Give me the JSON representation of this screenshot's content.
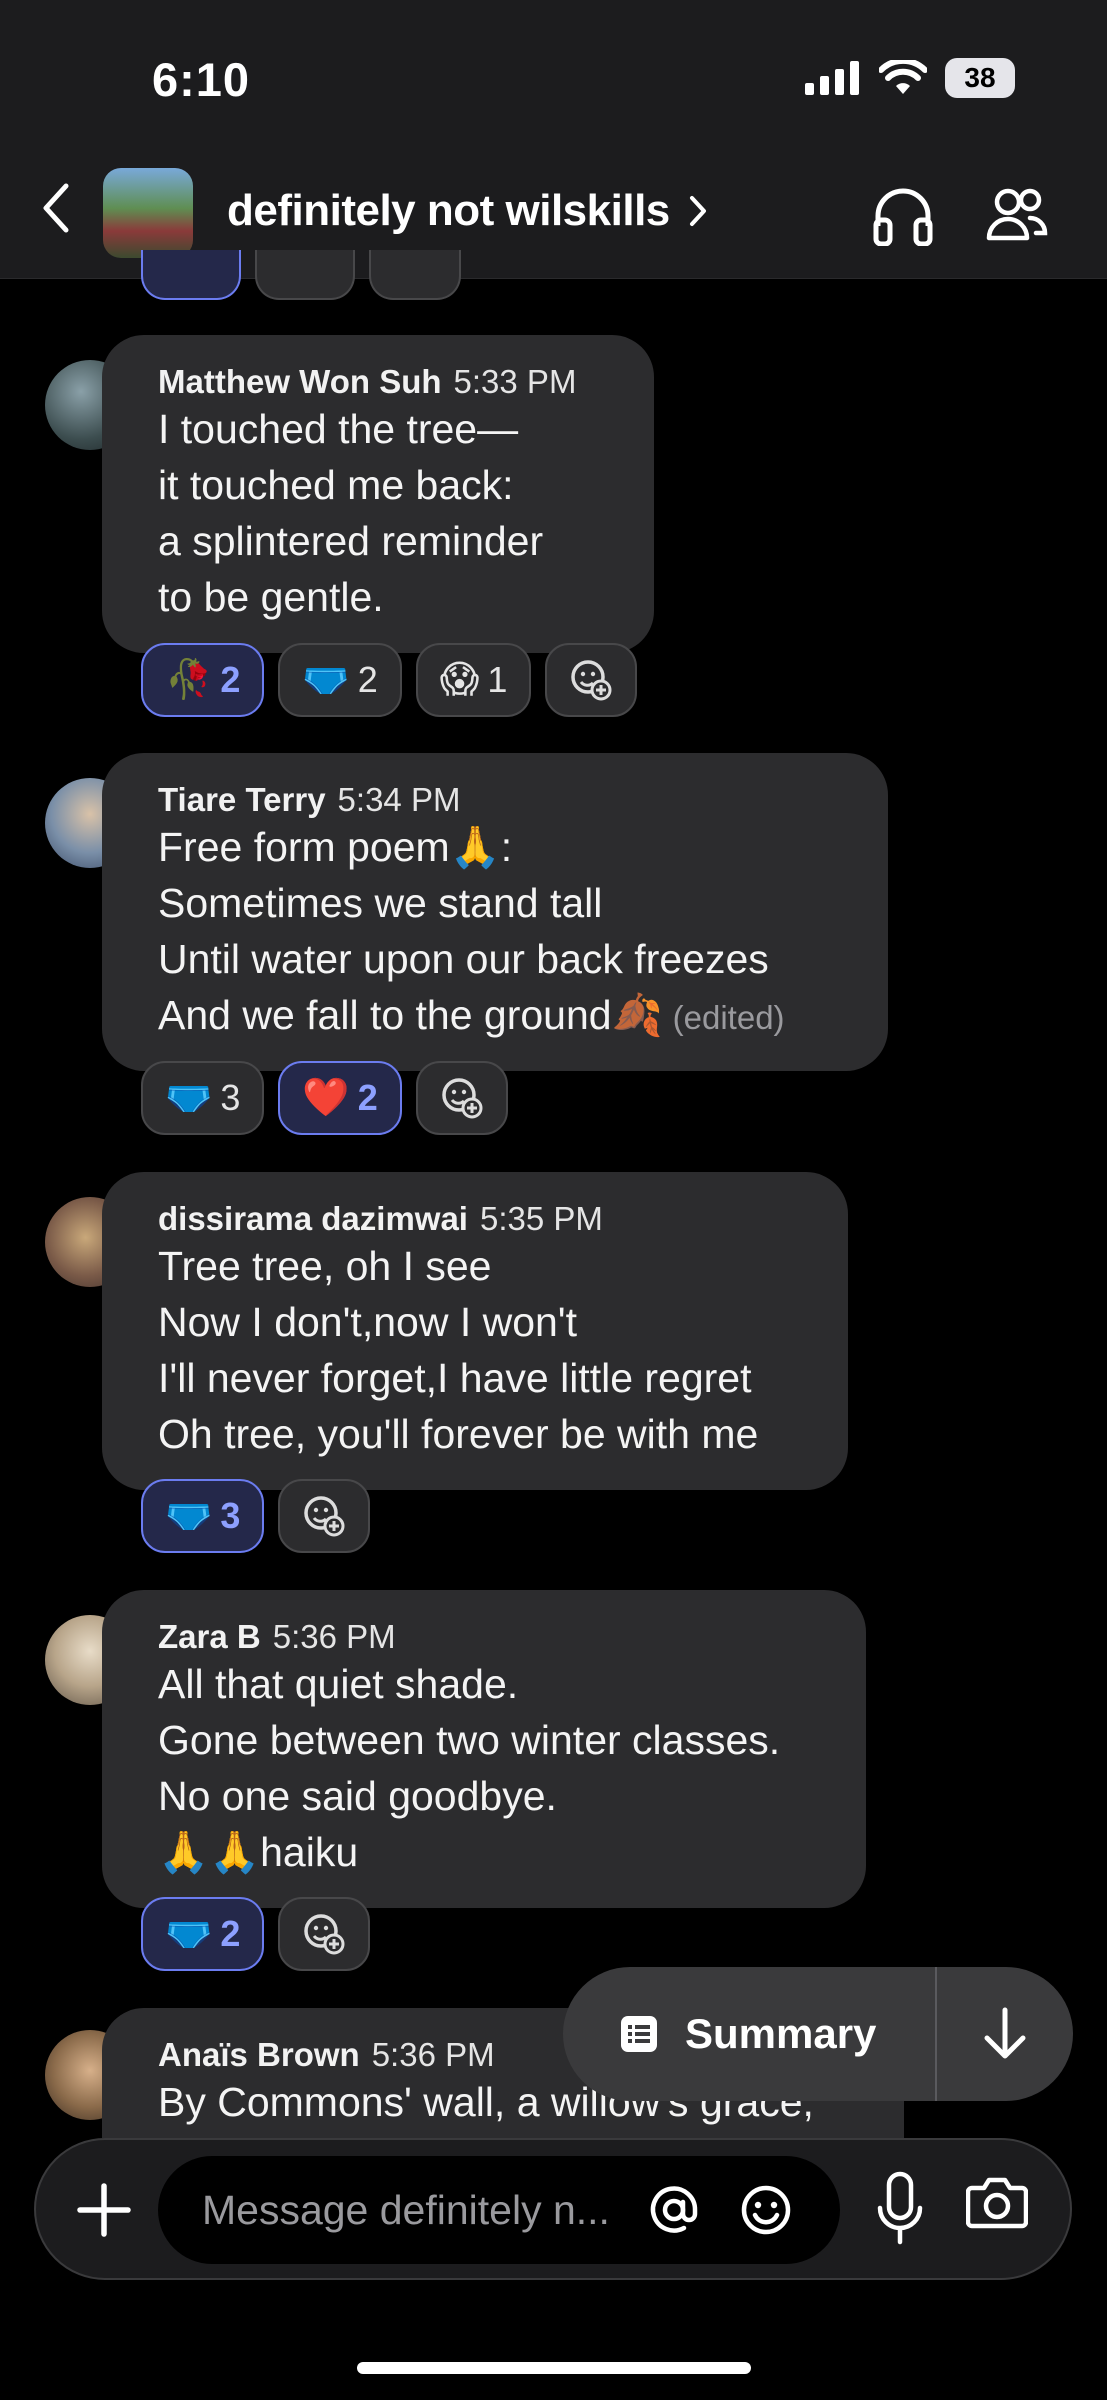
{
  "status_bar": {
    "time": "6:10",
    "battery": "38"
  },
  "header": {
    "title": "definitely not wilskills"
  },
  "messages": [
    {
      "sender": "Matthew Won Suh",
      "time": "5:33 PM",
      "lines": [
        "I touched the tree—",
        "it touched me back:",
        "a splintered reminder",
        "to be gentle."
      ],
      "reactions": [
        {
          "emoji": "🥀",
          "count": "2",
          "mine": true
        },
        {
          "emoji": "🩲",
          "count": "2",
          "mine": false
        },
        {
          "emoji": "😱",
          "count": "1",
          "mine": false
        }
      ]
    },
    {
      "sender": "Tiare Terry",
      "time": "5:34 PM",
      "lines": [
        "Free form poem🙏:",
        "Sometimes we stand tall",
        "Until water upon our back freezes",
        "And we fall to the ground🍂"
      ],
      "edited": "(edited)",
      "reactions": [
        {
          "emoji": "🩲",
          "count": "3",
          "mine": false
        },
        {
          "emoji": "❤️",
          "count": "2",
          "mine": true
        }
      ]
    },
    {
      "sender": "dissirama dazimwai",
      "time": "5:35 PM",
      "lines": [
        "Tree tree, oh I see",
        "Now I don't,now I won't",
        "I'll never forget,I have little regret",
        "Oh tree, you'll forever be with me"
      ],
      "reactions": [
        {
          "emoji": "🩲",
          "count": "3",
          "mine": true
        }
      ]
    },
    {
      "sender": "Zara B",
      "time": "5:36 PM",
      "lines": [
        "All that quiet shade.",
        "Gone between two winter classes.",
        "No one said goodbye.",
        "🙏🙏haiku"
      ],
      "reactions": [
        {
          "emoji": "🩲",
          "count": "2",
          "mine": true
        }
      ]
    },
    {
      "sender": "Anaïs Brown",
      "time": "5:36 PM",
      "lines": [
        "By Commons' wall, a willow's grace,"
      ]
    }
  ],
  "summary": {
    "label": "Summary"
  },
  "composer": {
    "placeholder": "Message definitely n..."
  },
  "icons": [
    "back-icon",
    "headphones-icon",
    "members-icon",
    "add-reaction-icon",
    "summary-list-icon",
    "arrow-down-icon",
    "plus-icon",
    "at-icon",
    "emoji-icon",
    "microphone-icon",
    "camera-icon"
  ],
  "colors": {
    "accent": "#6b7cf0",
    "bubble": "#2c2c2e",
    "background": "#000000"
  }
}
